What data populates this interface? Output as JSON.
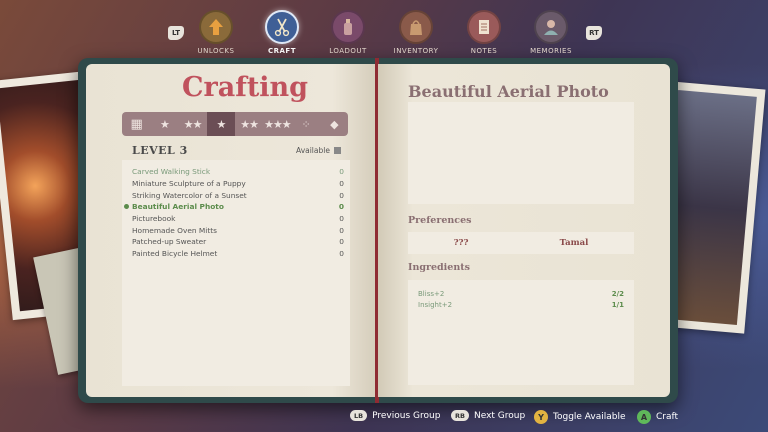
{
  "nav": {
    "left_bumper": "LT",
    "right_bumper": "RT",
    "items": [
      {
        "label": "UNLOCKS",
        "icon": "arrow-up-icon",
        "color": "#8a6a3a"
      },
      {
        "label": "CRAFT",
        "icon": "scissors-icon",
        "color": "#3f5f96",
        "active": true
      },
      {
        "label": "LOADOUT",
        "icon": "bottle-icon",
        "color": "#7a4a6a"
      },
      {
        "label": "INVENTORY",
        "icon": "bag-icon",
        "color": "#8a5a4a"
      },
      {
        "label": "NOTES",
        "icon": "notepad-icon",
        "color": "#9a5a5a"
      },
      {
        "label": "MEMORIES",
        "icon": "portrait-icon",
        "color": "#6a5a6a"
      }
    ]
  },
  "crafting": {
    "title": "Crafting",
    "tiers": [
      "▦",
      "★",
      "★★",
      "★",
      "★★",
      "★★★",
      "⁘",
      "◆"
    ],
    "active_tier": 3,
    "level_label": "LEVEL 3",
    "available_label": "Available",
    "items": [
      {
        "name": "Carved Walking Stick",
        "count": "0",
        "state": "muted"
      },
      {
        "name": "Miniature Sculpture of a Puppy",
        "count": "0",
        "state": "normal"
      },
      {
        "name": "Striking Watercolor of a Sunset",
        "count": "0",
        "state": "normal"
      },
      {
        "name": "Beautiful Aerial Photo",
        "count": "0",
        "state": "selected"
      },
      {
        "name": "Picturebook",
        "count": "0",
        "state": "normal"
      },
      {
        "name": "Homemade Oven Mitts",
        "count": "0",
        "state": "normal"
      },
      {
        "name": "Patched-up Sweater",
        "count": "0",
        "state": "normal"
      },
      {
        "name": "Painted Bicycle Helmet",
        "count": "0",
        "state": "normal"
      }
    ]
  },
  "detail": {
    "title": "Beautiful Aerial Photo",
    "preferences_label": "Preferences",
    "preferences": [
      "???",
      "Tamal"
    ],
    "ingredients_label": "Ingredients",
    "ingredients": [
      {
        "name": "Bliss+2",
        "qty": "2/2"
      },
      {
        "name": "Insight+2",
        "qty": "1/1"
      }
    ]
  },
  "hints": {
    "prev_key": "LB",
    "prev_label": "Previous Group",
    "next_key": "RB",
    "next_label": "Next Group",
    "toggle_key": "Y",
    "toggle_label": "Toggle Available",
    "craft_key": "A",
    "craft_label": "Craft"
  },
  "colors": {
    "accent": "#c0525d",
    "selected": "#5c8c4c",
    "y_button": "#e2b341",
    "a_button": "#5fb85a"
  }
}
